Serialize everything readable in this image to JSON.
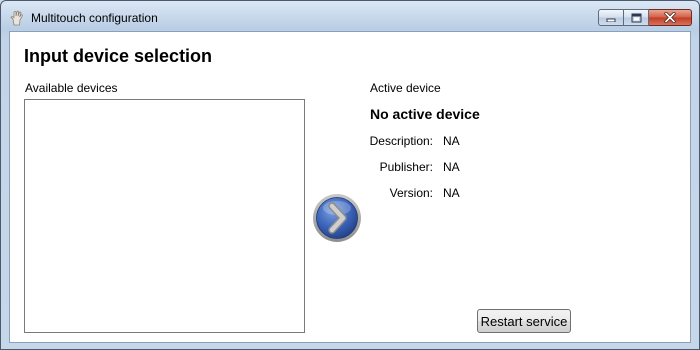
{
  "window": {
    "title": "Multitouch configuration"
  },
  "main": {
    "heading": "Input device selection",
    "available_devices_label": "Available devices",
    "available_devices": []
  },
  "active": {
    "section_label": "Active device",
    "device_name": "No active device",
    "description_label": "Description:",
    "description_value": "NA",
    "publisher_label": "Publisher:",
    "publisher_value": "NA",
    "version_label": "Version:",
    "version_value": "NA"
  },
  "buttons": {
    "restart_label": "Restart service"
  },
  "icons": {
    "app": "hand-touch-icon",
    "activate": "chevron-right-icon",
    "minimize": "minimize-icon",
    "maximize": "maximize-icon",
    "close": "close-icon"
  }
}
